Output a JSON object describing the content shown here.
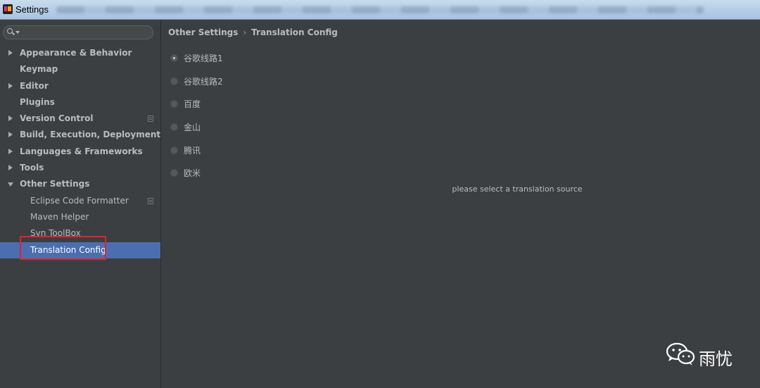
{
  "window": {
    "title": "Settings"
  },
  "sidebar": {
    "search": {
      "value": "",
      "placeholder": ""
    },
    "items": [
      {
        "label": "Appearance & Behavior"
      },
      {
        "label": "Keymap"
      },
      {
        "label": "Editor"
      },
      {
        "label": "Plugins"
      },
      {
        "label": "Version Control"
      },
      {
        "label": "Build, Execution, Deployment"
      },
      {
        "label": "Languages & Frameworks"
      },
      {
        "label": "Tools"
      },
      {
        "label": "Other Settings"
      }
    ],
    "children": [
      {
        "label": "Eclipse Code Formatter"
      },
      {
        "label": "Maven Helper"
      },
      {
        "label": "Svn ToolBox"
      },
      {
        "label": "Translation Config"
      }
    ],
    "selected": "Translation Config"
  },
  "breadcrumb": {
    "parent": "Other Settings",
    "separator": "›",
    "current": "Translation Config"
  },
  "sources": {
    "options": [
      {
        "label": "谷歌线路1",
        "checked": true
      },
      {
        "label": "谷歌线路2",
        "checked": false
      },
      {
        "label": "百度",
        "checked": false
      },
      {
        "label": "金山",
        "checked": false
      },
      {
        "label": "腾讯",
        "checked": false
      },
      {
        "label": "欧米",
        "checked": false
      }
    ],
    "hint": "please select a translation source"
  },
  "watermark": {
    "text": "雨忧",
    "icon": "wechat-icon"
  },
  "colors": {
    "background": "#3c3f41",
    "selection": "#4b6eaf",
    "highlight_border": "#e0232d",
    "text": "#bbbbbb"
  }
}
